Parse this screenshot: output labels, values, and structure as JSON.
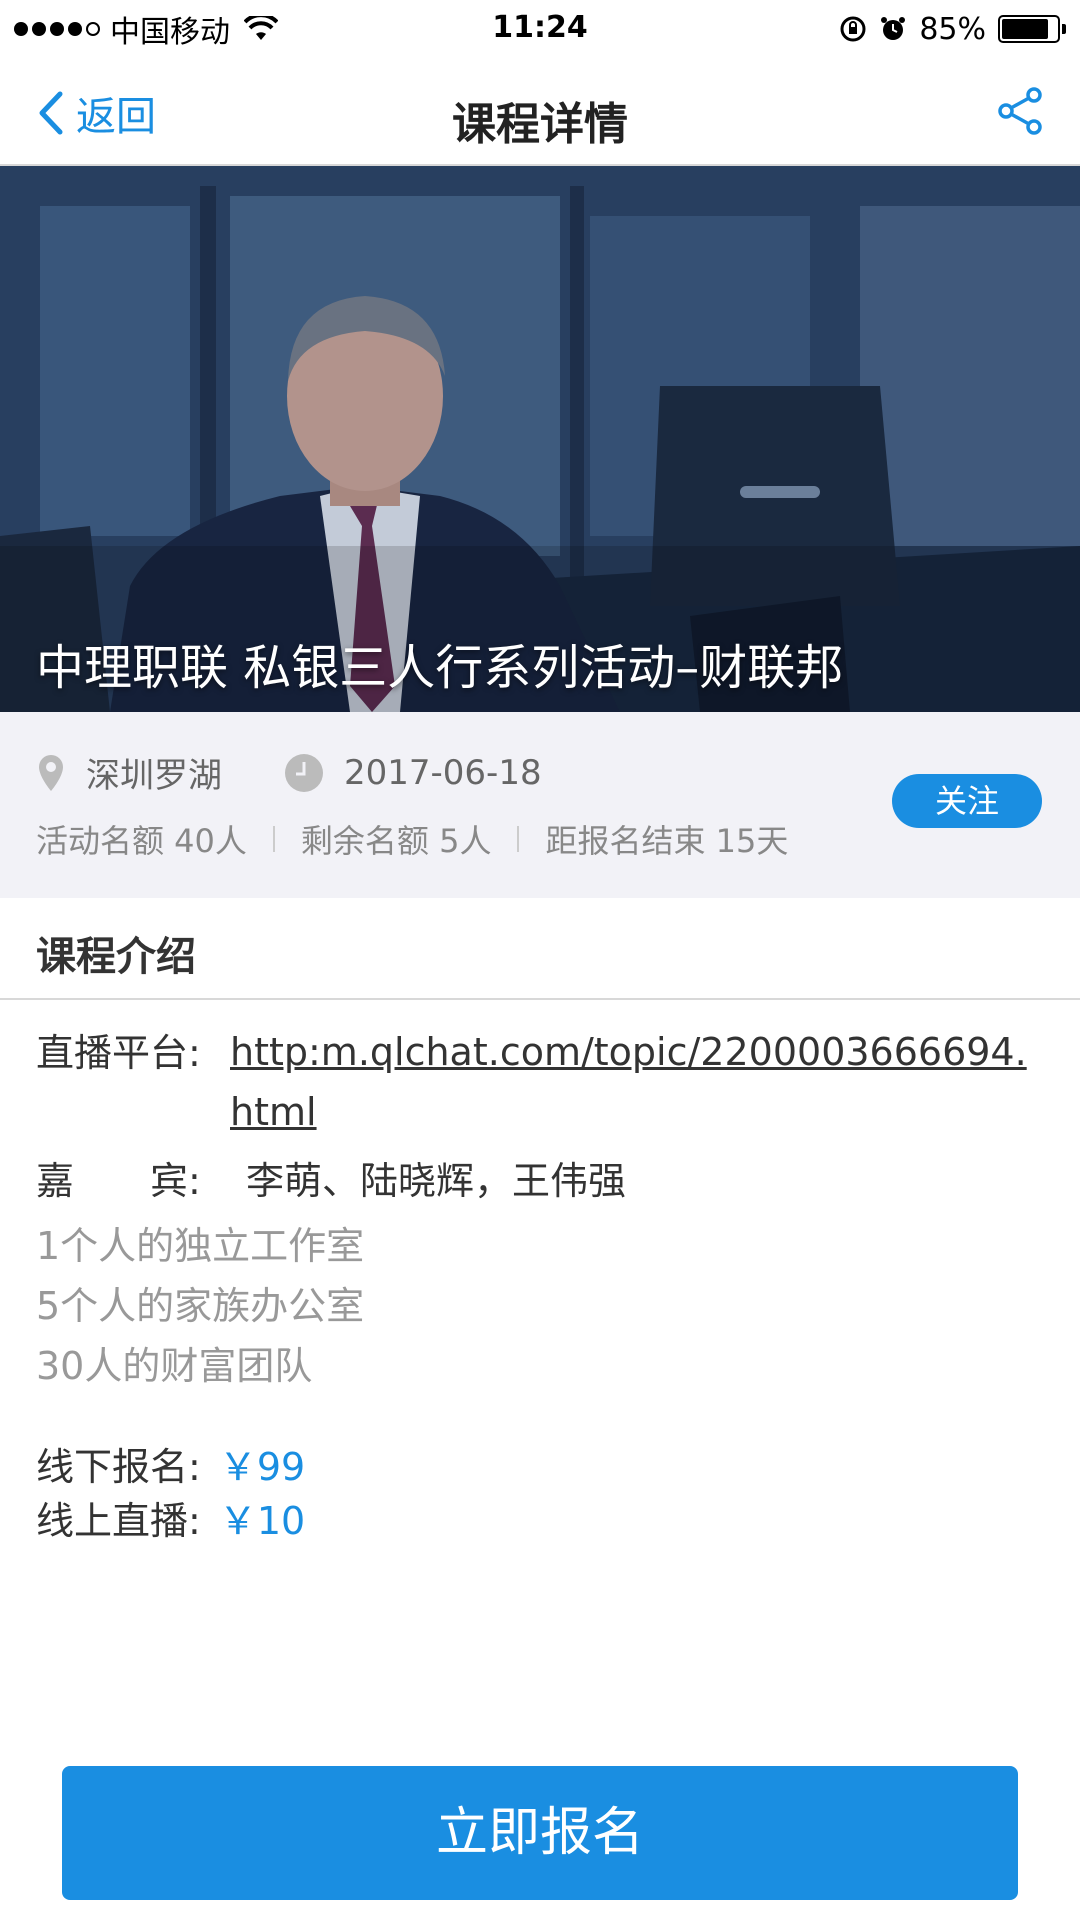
{
  "status_bar": {
    "carrier": "中国移动",
    "time": "11:24",
    "battery_percent": "85%",
    "battery_level": 0.85
  },
  "nav": {
    "back_label": "返回",
    "title": "课程详情"
  },
  "hero": {
    "title": "中理职联 私银三人行系列活动–财联邦"
  },
  "info": {
    "location": "深圳罗湖",
    "date": "2017-06-18",
    "quota": "活动名额 40人",
    "remaining": "剩余名额 5人",
    "deadline": "距报名结束 15天",
    "follow_label": "关注"
  },
  "section": {
    "title": "课程介绍"
  },
  "content": {
    "platform_label": "直播平台:",
    "platform_url": "http:m.qlchat.com/topic/2200003666694.html",
    "guest_label": "嘉　　宾:",
    "guests": "李萌、陆晓辉，王伟强",
    "desc_lines": [
      "1个人的独立工作室",
      "5个人的家族办公室",
      "30人的财富团队"
    ],
    "offline_label": "线下报名:",
    "offline_price": "￥99",
    "online_label": "线上直播:",
    "online_price": "￥10"
  },
  "cta": {
    "label": "立即报名"
  },
  "colors": {
    "accent": "#1a8ee1"
  }
}
